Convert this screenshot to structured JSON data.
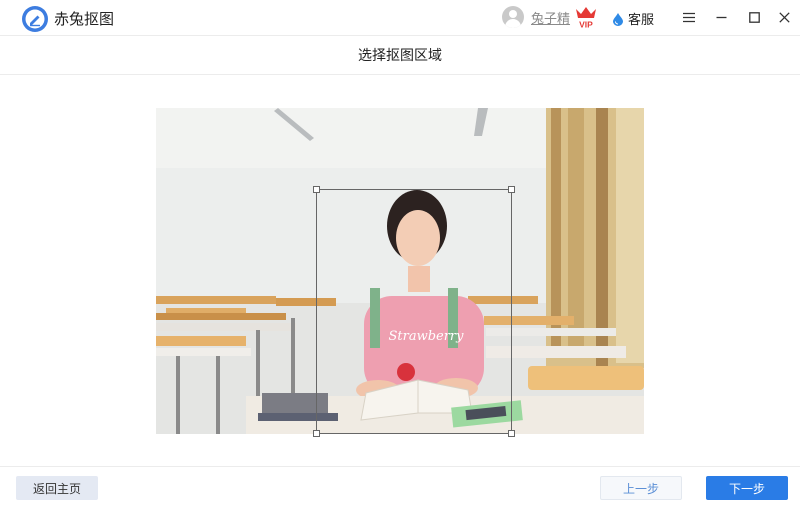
{
  "titlebar": {
    "app_name": "赤兔抠图",
    "username": "兔子精",
    "vip_badge": "VIP",
    "service_label": "客服",
    "icons": [
      "app-logo-icon",
      "avatar-icon",
      "vip-crown-icon",
      "service-drop-icon",
      "menu-icon",
      "minimize-icon",
      "maximize-icon",
      "close-icon"
    ]
  },
  "step": {
    "title": "选择抠图区域"
  },
  "footer": {
    "home_label": "返回主页",
    "prev_label": "上一步",
    "next_label": "下一步"
  },
  "colors": {
    "accent": "#2a7ce6",
    "vip_red": "#e53935",
    "secondary_button_bg": "#e4e9f3",
    "divider": "#ececec"
  }
}
